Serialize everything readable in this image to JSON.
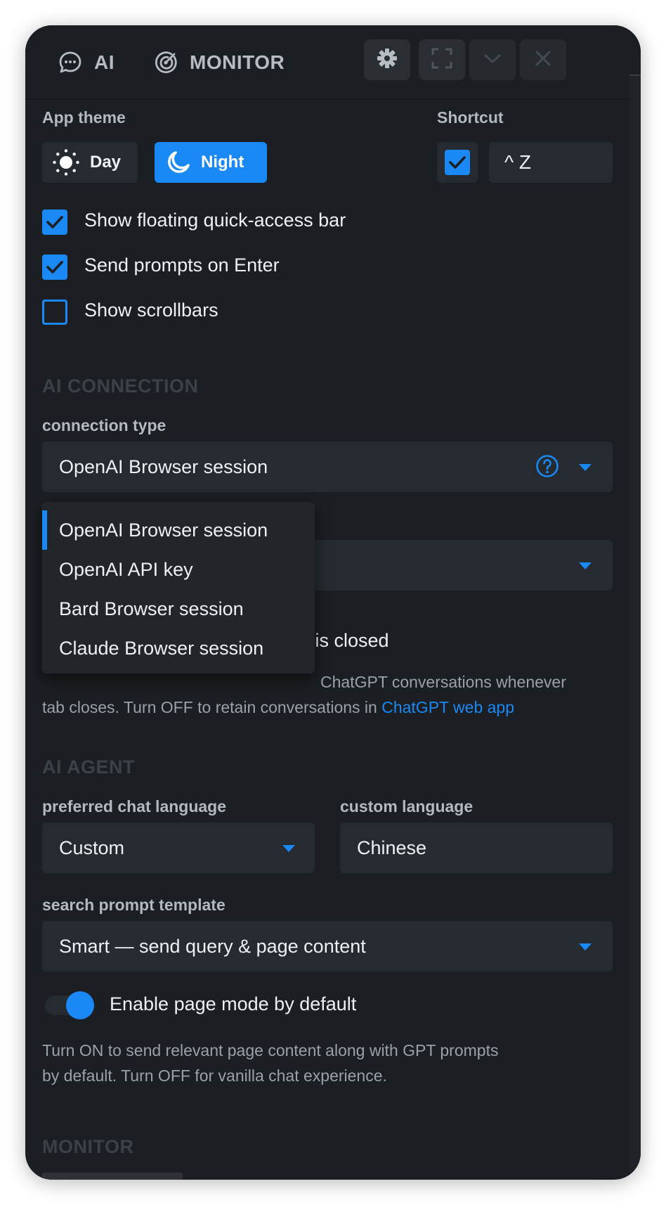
{
  "header": {
    "tabs": [
      {
        "label": "AI",
        "icon": "chat-bubble-icon"
      },
      {
        "label": "MONITOR",
        "icon": "radar-icon"
      }
    ],
    "buttons": [
      {
        "name": "settings-button",
        "icon": "gear-icon"
      },
      {
        "name": "fullscreen-button",
        "icon": "expand-icon"
      },
      {
        "name": "minimize-button",
        "icon": "chevron-down-icon"
      },
      {
        "name": "close-button",
        "icon": "close-icon"
      }
    ]
  },
  "theme": {
    "label": "App theme",
    "day_label": "Day",
    "night_label": "Night",
    "selected": "Night",
    "accent": "#1a89f5"
  },
  "shortcut": {
    "label": "Shortcut",
    "enabled": true,
    "value": "^ Z"
  },
  "options": [
    {
      "label": "Show floating quick-access bar",
      "checked": true
    },
    {
      "label": "Send prompts on Enter",
      "checked": true
    },
    {
      "label": "Show scrollbars",
      "checked": false
    }
  ],
  "ai_connection": {
    "section_title": "AI CONNECTION",
    "connection_type_label": "connection type",
    "connection_type_value": "OpenAI Browser session",
    "dropdown_options": [
      "OpenAI Browser session",
      "OpenAI API key",
      "Bard Browser session",
      "Claude Browser session"
    ],
    "dropdown_selected_index": 0,
    "hidden_option_text_visible": "b is closed",
    "description_visible_line1": "ChatGPT conversations whenever",
    "description_line2": "tab closes. Turn OFF to retain conversations in ",
    "description_link": "ChatGPT web app"
  },
  "ai_agent": {
    "section_title": "AI AGENT",
    "chat_language_label": "preferred chat language",
    "chat_language_value": "Custom",
    "custom_language_label": "custom language",
    "custom_language_value": "Chinese",
    "prompt_template_label": "search prompt template",
    "prompt_template_value": "Smart — send query & page content",
    "page_mode_label": "Enable page mode by default",
    "page_mode_on": true,
    "page_mode_description_line1": "Turn ON to send relevant page content along with GPT prompts",
    "page_mode_description_line2": "by default. Turn OFF for vanilla chat experience."
  },
  "monitor": {
    "section_title": "MONITOR"
  }
}
